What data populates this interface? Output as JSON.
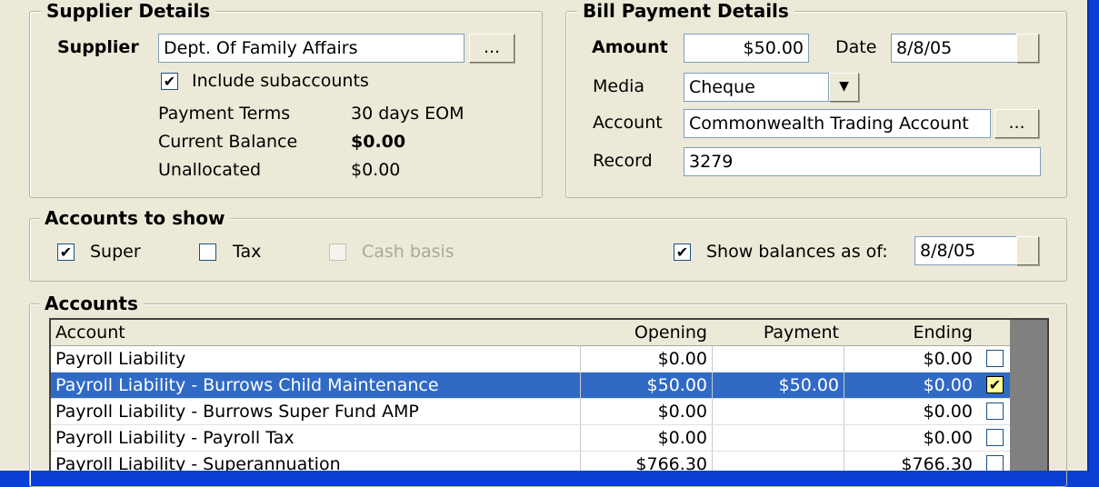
{
  "supplier_details": {
    "legend": "Supplier Details",
    "supplier_label": "Supplier",
    "supplier_value": "Dept. Of Family Affairs",
    "lookup_label": "...",
    "include_subaccounts_label": "Include subaccounts",
    "include_subaccounts_checked": true,
    "payment_terms_label": "Payment Terms",
    "payment_terms_value": "30 days EOM",
    "current_balance_label": "Current Balance",
    "current_balance_value": "$0.00",
    "unallocated_label": "Unallocated",
    "unallocated_value": "$0.00"
  },
  "bill_payment": {
    "legend": "Bill Payment Details",
    "amount_label": "Amount",
    "amount_value": "$50.00",
    "date_label": "Date",
    "date_value": "8/8/05",
    "media_label": "Media",
    "media_value": "Cheque",
    "account_label": "Account",
    "account_value": "Commonwealth Trading Account",
    "account_lookup_label": "...",
    "record_label": "Record",
    "record_value": "3279"
  },
  "accounts_to_show": {
    "legend": "Accounts to show",
    "super_label": "Super",
    "super_checked": true,
    "tax_label": "Tax",
    "tax_checked": false,
    "cash_basis_label": "Cash basis",
    "cash_basis_checked": false,
    "show_balances_label": "Show balances as of:",
    "show_balances_checked": true,
    "balances_date": "8/8/05"
  },
  "accounts": {
    "legend": "Accounts",
    "columns": {
      "account": "Account",
      "opening": "Opening",
      "payment": "Payment",
      "ending": "Ending"
    },
    "rows": [
      {
        "account": "Payroll Liability",
        "opening": "$0.00",
        "payment": "",
        "ending": "$0.00",
        "checked": false,
        "selected": false
      },
      {
        "account": "Payroll Liability - Burrows Child Maintenance",
        "opening": "$50.00",
        "payment": "$50.00",
        "ending": "$0.00",
        "checked": true,
        "selected": true
      },
      {
        "account": "Payroll Liability - Burrows Super Fund AMP",
        "opening": "$0.00",
        "payment": "",
        "ending": "$0.00",
        "checked": false,
        "selected": false
      },
      {
        "account": "Payroll Liability - Payroll Tax",
        "opening": "$0.00",
        "payment": "",
        "ending": "$0.00",
        "checked": false,
        "selected": false
      },
      {
        "account": "Payroll Liability - Superannuation",
        "opening": "$766.30",
        "payment": "",
        "ending": "$766.30",
        "checked": false,
        "selected": false
      }
    ]
  },
  "colors": {
    "selection": "#316ac5",
    "window_bg": "#ece9d8",
    "frame": "#0a3fd6"
  }
}
